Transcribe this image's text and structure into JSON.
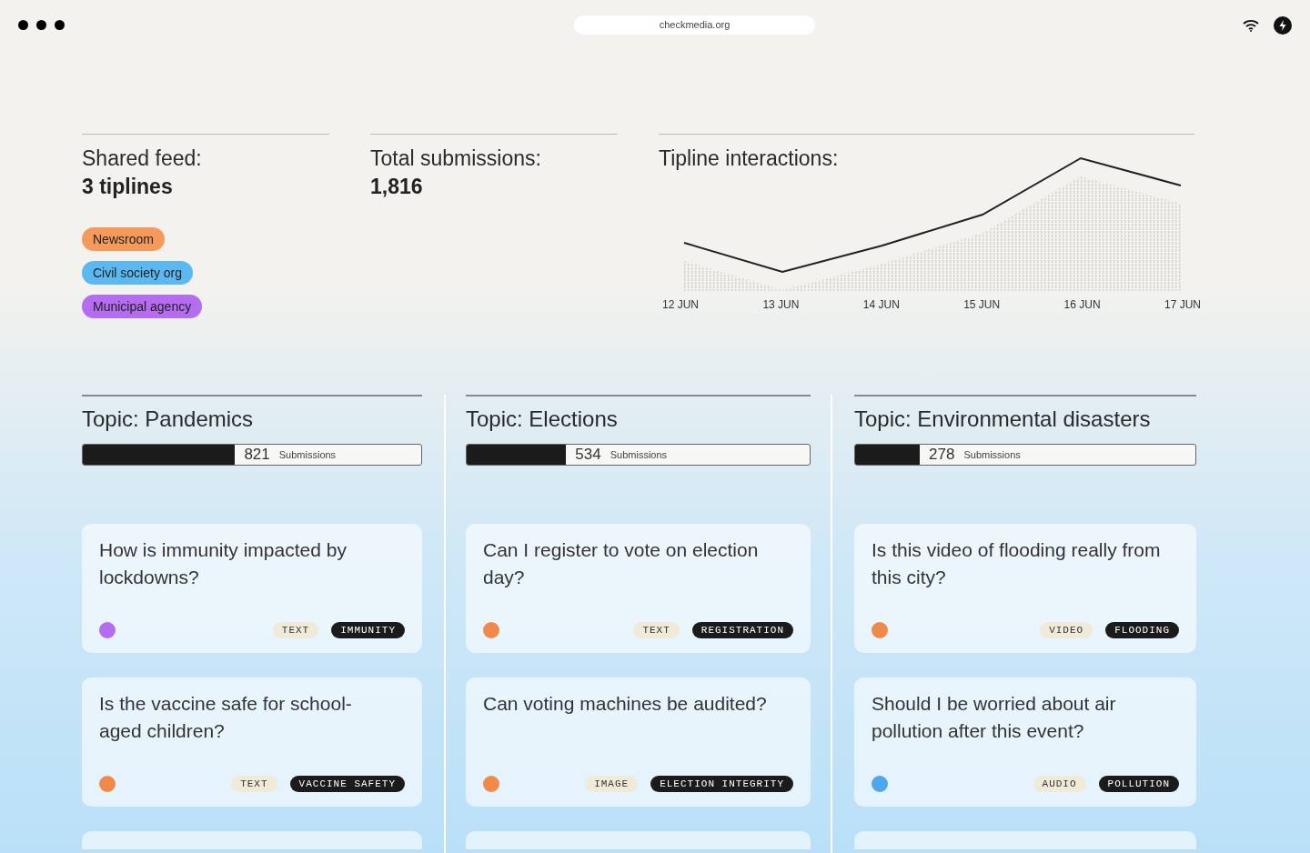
{
  "browser": {
    "url": "checkmedia.org"
  },
  "stats": [
    {
      "label": "Shared feed:",
      "value": "3 tiplines"
    },
    {
      "label": "Total submissions:",
      "value": "1,816"
    }
  ],
  "tiplines": [
    {
      "name": "Newsroom",
      "color": "#f59a5a"
    },
    {
      "name": "Civil society org",
      "color": "#5bb8f0"
    },
    {
      "name": "Municipal agency",
      "color": "#b56cf0"
    }
  ],
  "interactions": {
    "title": "Tipline interactions:",
    "x_labels": [
      "12 JUN",
      "13 JUN",
      "14 JUN",
      "15 JUN",
      "16 JUN",
      "17 JUN"
    ]
  },
  "topics": [
    {
      "title": "Topic: Pandemics",
      "count": "821",
      "unit": "Submissions",
      "level": 0.45,
      "cards": [
        {
          "question": "How is immunity impacted by lockdowns?",
          "color": "#b56cf0",
          "media": "TEXT",
          "tag": "IMMUNITY"
        },
        {
          "question": "Is the vaccine safe for school-aged children?",
          "color": "#f08a4a",
          "media": "TEXT",
          "tag": "VACCINE SAFETY"
        }
      ]
    },
    {
      "title": "Topic: Elections",
      "count": "534",
      "unit": "Submissions",
      "level": 0.29,
      "cards": [
        {
          "question": "Can I register to vote on election day?",
          "color": "#f08a4a",
          "media": "TEXT",
          "tag": "REGISTRATION"
        },
        {
          "question": "Can voting machines be audited?",
          "color": "#f08a4a",
          "media": "IMAGE",
          "tag": "ELECTION INTEGRITY"
        }
      ]
    },
    {
      "title": "Topic: Environmental disasters",
      "count": "278",
      "unit": "Submissions",
      "level": 0.19,
      "cards": [
        {
          "question": "Is this video of flooding really from this city?",
          "color": "#f08a4a",
          "media": "VIDEO",
          "tag": "FLOODING"
        },
        {
          "question": "Should I be worried about air pollution after this event?",
          "color": "#4ea6ee",
          "media": "AUDIO",
          "tag": "POLLUTION"
        }
      ]
    }
  ]
}
